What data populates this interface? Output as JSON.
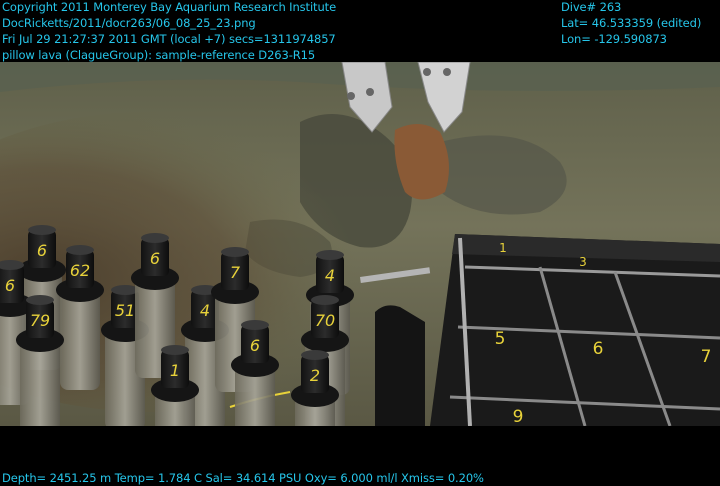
{
  "header": {
    "left_lines": [
      "Copyright 2011 Monterey Bay Aquarium Research Institute",
      "DocRicketts/2011/docr263/06_08_25_23.png",
      "Fri Jul 29 21:27:37 2011 GMT (local +7)  secs=1311974857",
      "pillow lava (ClagueGroup): sample-reference D263-R15"
    ],
    "right_lines": [
      "Dive# 263",
      "Lat= 46.533359 (edited)",
      "Lon= -129.590873"
    ]
  },
  "footer": {
    "telemetry": "Depth= 2451.25 m  Temp= 1.784 C  Sal= 34.614 PSU  Oxy= 6.000 ml/l  Xmiss= 0.20%"
  },
  "scene": {
    "tube_labels": [
      "6",
      "6",
      "62",
      "79",
      "51",
      "6",
      "4",
      "7",
      "4",
      "1",
      "6",
      "70",
      "2"
    ],
    "tray_labels": [
      "1",
      "3",
      "5",
      "6",
      "7",
      "9"
    ]
  },
  "colors": {
    "overlay_text": "#26c6ea",
    "seafloor": "#6b6a4a",
    "sediment_cloud": "#5a4a34",
    "label_yellow": "#e8d23a"
  }
}
